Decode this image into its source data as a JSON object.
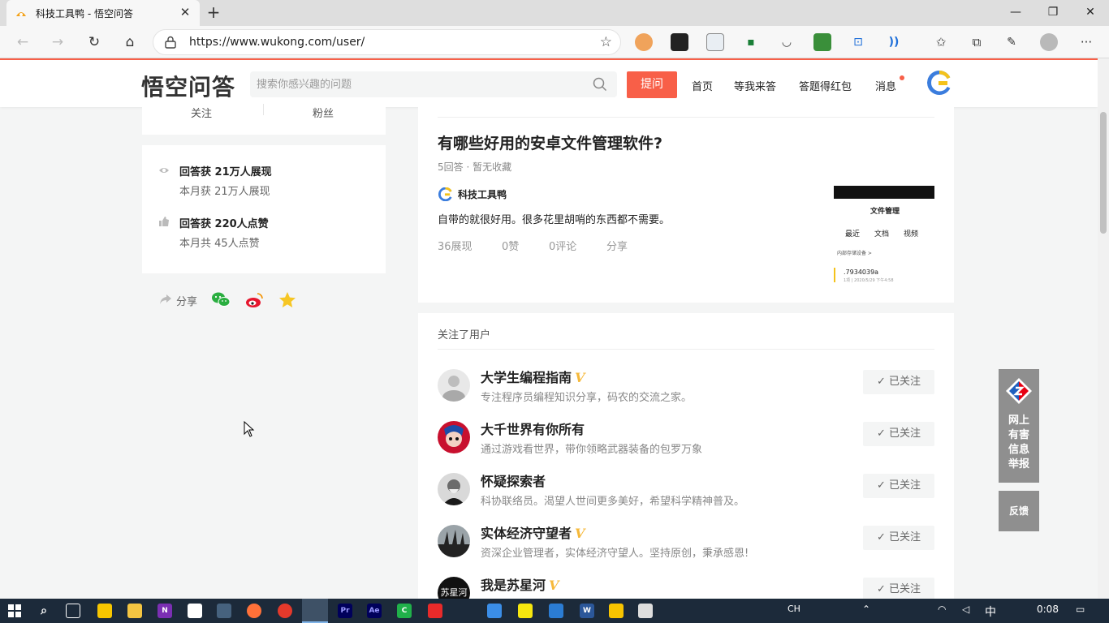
{
  "browser": {
    "tab_title": "科技工具鸭 - 悟空问答",
    "tab_close": "✕",
    "new_tab": "+",
    "url": "https://www.wukong.com/user/",
    "window_controls": [
      "—",
      "❐",
      "✕"
    ]
  },
  "header": {
    "logo": "悟空问答",
    "search_placeholder": "搜索你感兴趣的问题",
    "ask_button": "提问",
    "nav": [
      "首页",
      "等我来答",
      "答题得红包",
      "消息"
    ],
    "accent": "#f85f48"
  },
  "profile": {
    "stats_labels": [
      "关注",
      "粉丝"
    ],
    "achievements": [
      {
        "main": "回答获 21万人展现",
        "sub": "本月获 21万人展现",
        "icon": "eye-icon"
      },
      {
        "main": "回答获 220人点赞",
        "sub": "本月共 45人点赞",
        "icon": "thumbs-up-icon"
      }
    ],
    "share_label": "分享"
  },
  "answer": {
    "title": "有哪些好用的安卓文件管理软件?",
    "meta": "5回答 · 暂无收藏",
    "author": "科技工具鸭",
    "body": "自带的就很好用。很多花里胡哨的东西都不需要。",
    "stats": [
      "36展现",
      "0赞",
      "0评论",
      "分享"
    ],
    "thumbnail": {
      "title": "文件管理",
      "tabs": [
        "最近",
        "文档",
        "视频"
      ],
      "storage": "内部存储设备 >",
      "file": ".7934039a",
      "file_meta": "1项 | 2020/5/29 下午4:58"
    }
  },
  "following": {
    "title": "关注了用户",
    "button_label": "已关注",
    "users": [
      {
        "name": "大学生编程指南",
        "verified": "V",
        "desc": "专注程序员编程知识分享，码农的交流之家。"
      },
      {
        "name": "大千世界有你所有",
        "verified": "",
        "desc": "通过游戏看世界，带你领略武器装备的包罗万象"
      },
      {
        "name": "怀疑探索者",
        "verified": "",
        "desc": "科协联络员。渴望人世间更多美好，希望科学精神普及。"
      },
      {
        "name": "实体经济守望者",
        "verified": "V",
        "desc": "资深企业管理者，实体经济守望人。坚持原创，秉承感恩!"
      },
      {
        "name": "我是苏星河",
        "verified": "V",
        "desc": "",
        "avatar_text": "苏星河"
      }
    ]
  },
  "float": {
    "report": "网上有害信息举报",
    "report_lines": [
      "网上",
      "有害",
      "信息",
      "举报"
    ],
    "feedback": "反馈"
  },
  "taskbar": {
    "ime": "CH",
    "lang": "中",
    "time": "0:08"
  }
}
